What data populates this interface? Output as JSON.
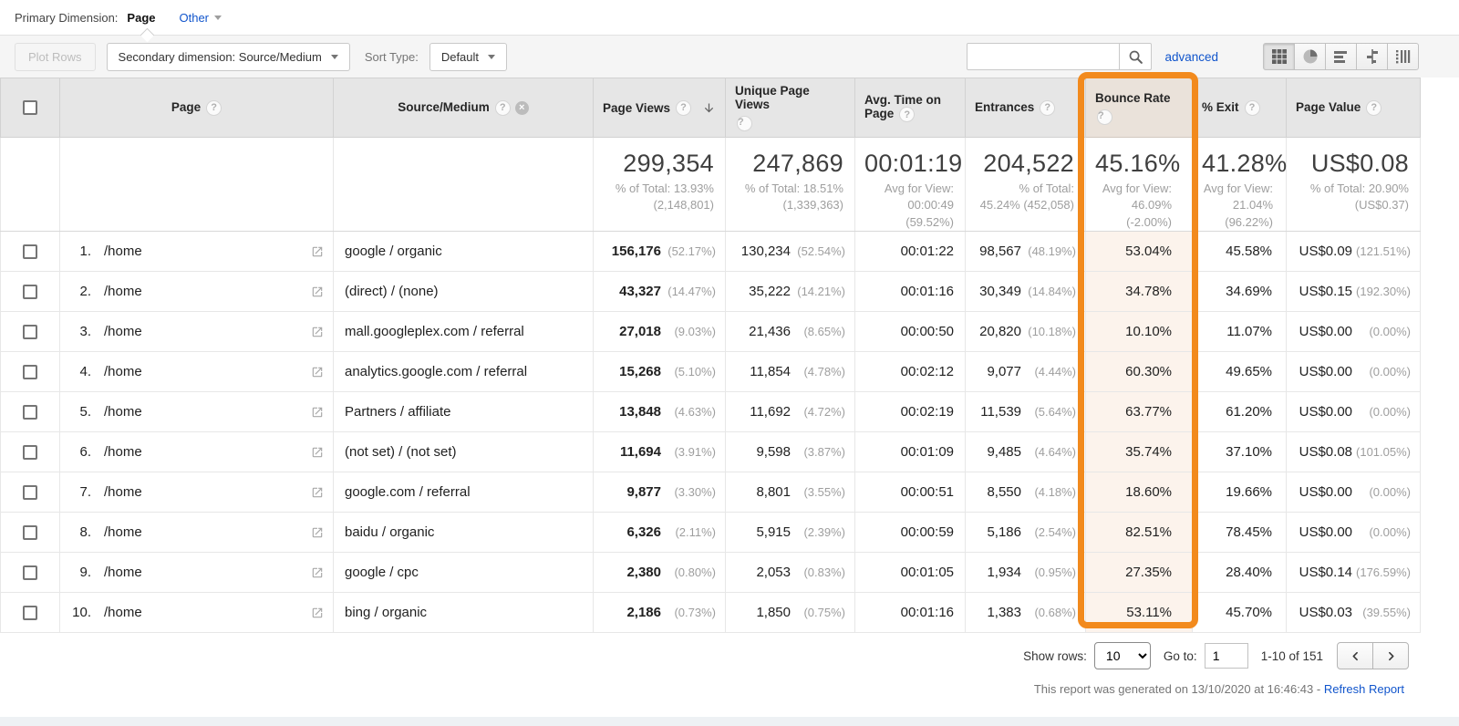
{
  "colors": {
    "accent_orange": "#F28A1D",
    "highlight_cell_bg": "#FCF3EC",
    "highlight_header_bg": "#EAE2DA",
    "link_blue": "#1155CC",
    "header_bg": "#E6E6E6",
    "toolbar_bg": "#F5F5F5"
  },
  "primary_dimension": {
    "label": "Primary Dimension:",
    "active_tab": "Page",
    "other_tab": "Other"
  },
  "toolbar": {
    "plot_rows": "Plot Rows",
    "secondary_dimension": "Secondary dimension: Source/Medium",
    "sort_type_label": "Sort Type:",
    "sort_type_value": "Default",
    "search_value": "",
    "advanced": "advanced",
    "view_buttons": [
      "data-grid",
      "percentage-pie",
      "performance-bars",
      "comparison",
      "pivot"
    ]
  },
  "table": {
    "headers": {
      "page": "Page",
      "source_medium": "Source/Medium",
      "page_views": "Page Views",
      "unique_page_views": "Unique Page Views",
      "avg_time_on_page": "Avg. Time on Page",
      "entrances": "Entrances",
      "bounce_rate": "Bounce Rate",
      "percent_exit": "% Exit",
      "page_value": "Page Value"
    },
    "summary": {
      "page_views": {
        "value": "299,354",
        "sub": "% of Total: 13.93%\n(2,148,801)"
      },
      "unique_page_views": {
        "value": "247,869",
        "sub": "% of Total: 18.51%\n(1,339,363)"
      },
      "avg_time_on_page": {
        "value": "00:01:19",
        "sub": "Avg for View:\n00:00:49\n(59.52%)"
      },
      "entrances": {
        "value": "204,522",
        "sub": "% of Total:\n45.24% (452,058)"
      },
      "bounce_rate": {
        "value": "45.16%",
        "sub": "Avg for View:\n46.09%\n(-2.00%)"
      },
      "percent_exit": {
        "value": "41.28%",
        "sub": "Avg for View:\n21.04%\n(96.22%)"
      },
      "page_value": {
        "value": "US$0.08",
        "sub": "% of Total: 20.90%\n(US$0.37)"
      }
    },
    "rows": [
      {
        "rank": "1.",
        "page": "/home",
        "source_medium": "google / organic",
        "page_views": "156,176",
        "page_views_pct": "(52.17%)",
        "unique_page_views": "130,234",
        "unique_page_views_pct": "(52.54%)",
        "avg_time_on_page": "00:01:22",
        "entrances": "98,567",
        "entrances_pct": "(48.19%)",
        "bounce_rate": "53.04%",
        "percent_exit": "45.58%",
        "page_value": "US$0.09",
        "page_value_pct": "(121.51%)"
      },
      {
        "rank": "2.",
        "page": "/home",
        "source_medium": "(direct) / (none)",
        "page_views": "43,327",
        "page_views_pct": "(14.47%)",
        "unique_page_views": "35,222",
        "unique_page_views_pct": "(14.21%)",
        "avg_time_on_page": "00:01:16",
        "entrances": "30,349",
        "entrances_pct": "(14.84%)",
        "bounce_rate": "34.78%",
        "percent_exit": "34.69%",
        "page_value": "US$0.15",
        "page_value_pct": "(192.30%)"
      },
      {
        "rank": "3.",
        "page": "/home",
        "source_medium": "mall.googleplex.com / referral",
        "page_views": "27,018",
        "page_views_pct": "(9.03%)",
        "unique_page_views": "21,436",
        "unique_page_views_pct": "(8.65%)",
        "avg_time_on_page": "00:00:50",
        "entrances": "20,820",
        "entrances_pct": "(10.18%)",
        "bounce_rate": "10.10%",
        "percent_exit": "11.07%",
        "page_value": "US$0.00",
        "page_value_pct": "(0.00%)"
      },
      {
        "rank": "4.",
        "page": "/home",
        "source_medium": "analytics.google.com / referral",
        "page_views": "15,268",
        "page_views_pct": "(5.10%)",
        "unique_page_views": "11,854",
        "unique_page_views_pct": "(4.78%)",
        "avg_time_on_page": "00:02:12",
        "entrances": "9,077",
        "entrances_pct": "(4.44%)",
        "bounce_rate": "60.30%",
        "percent_exit": "49.65%",
        "page_value": "US$0.00",
        "page_value_pct": "(0.00%)"
      },
      {
        "rank": "5.",
        "page": "/home",
        "source_medium": "Partners / affiliate",
        "page_views": "13,848",
        "page_views_pct": "(4.63%)",
        "unique_page_views": "11,692",
        "unique_page_views_pct": "(4.72%)",
        "avg_time_on_page": "00:02:19",
        "entrances": "11,539",
        "entrances_pct": "(5.64%)",
        "bounce_rate": "63.77%",
        "percent_exit": "61.20%",
        "page_value": "US$0.00",
        "page_value_pct": "(0.00%)"
      },
      {
        "rank": "6.",
        "page": "/home",
        "source_medium": "(not set) / (not set)",
        "page_views": "11,694",
        "page_views_pct": "(3.91%)",
        "unique_page_views": "9,598",
        "unique_page_views_pct": "(3.87%)",
        "avg_time_on_page": "00:01:09",
        "entrances": "9,485",
        "entrances_pct": "(4.64%)",
        "bounce_rate": "35.74%",
        "percent_exit": "37.10%",
        "page_value": "US$0.08",
        "page_value_pct": "(101.05%)"
      },
      {
        "rank": "7.",
        "page": "/home",
        "source_medium": "google.com / referral",
        "page_views": "9,877",
        "page_views_pct": "(3.30%)",
        "unique_page_views": "8,801",
        "unique_page_views_pct": "(3.55%)",
        "avg_time_on_page": "00:00:51",
        "entrances": "8,550",
        "entrances_pct": "(4.18%)",
        "bounce_rate": "18.60%",
        "percent_exit": "19.66%",
        "page_value": "US$0.00",
        "page_value_pct": "(0.00%)"
      },
      {
        "rank": "8.",
        "page": "/home",
        "source_medium": "baidu / organic",
        "page_views": "6,326",
        "page_views_pct": "(2.11%)",
        "unique_page_views": "5,915",
        "unique_page_views_pct": "(2.39%)",
        "avg_time_on_page": "00:00:59",
        "entrances": "5,186",
        "entrances_pct": "(2.54%)",
        "bounce_rate": "82.51%",
        "percent_exit": "78.45%",
        "page_value": "US$0.00",
        "page_value_pct": "(0.00%)"
      },
      {
        "rank": "9.",
        "page": "/home",
        "source_medium": "google / cpc",
        "page_views": "2,380",
        "page_views_pct": "(0.80%)",
        "unique_page_views": "2,053",
        "unique_page_views_pct": "(0.83%)",
        "avg_time_on_page": "00:01:05",
        "entrances": "1,934",
        "entrances_pct": "(0.95%)",
        "bounce_rate": "27.35%",
        "percent_exit": "28.40%",
        "page_value": "US$0.14",
        "page_value_pct": "(176.59%)"
      },
      {
        "rank": "10.",
        "page": "/home",
        "source_medium": "bing / organic",
        "page_views": "2,186",
        "page_views_pct": "(0.73%)",
        "unique_page_views": "1,850",
        "unique_page_views_pct": "(0.75%)",
        "avg_time_on_page": "00:01:16",
        "entrances": "1,383",
        "entrances_pct": "(0.68%)",
        "bounce_rate": "53.11%",
        "percent_exit": "45.70%",
        "page_value": "US$0.03",
        "page_value_pct": "(39.55%)"
      }
    ]
  },
  "footer": {
    "show_rows_label": "Show rows:",
    "show_rows_value": "10",
    "go_to_label": "Go to:",
    "go_to_value": "1",
    "range": "1-10 of 151"
  },
  "status": {
    "text": "This report was generated on 13/10/2020 at 16:46:43 -",
    "refresh": "Refresh Report"
  }
}
